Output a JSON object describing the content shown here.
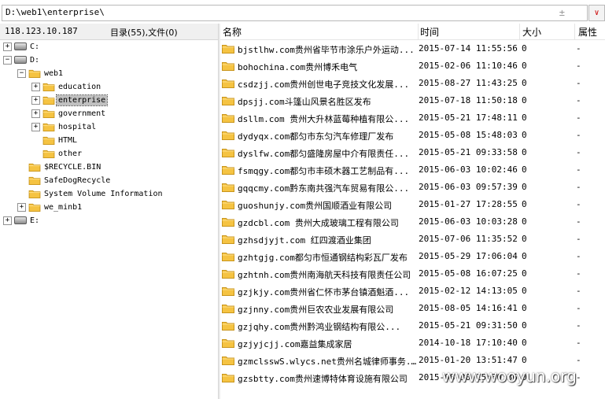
{
  "address": {
    "path": "D:\\web1\\enterprise\\",
    "icons": [
      "plus-minus-icon",
      "chevron-down-icon"
    ]
  },
  "left_header": {
    "ip": "118.123.10.187",
    "counts": "目录(55),文件(0)"
  },
  "tree": [
    {
      "label": "C:",
      "kind": "drive",
      "expander": "+"
    },
    {
      "label": "D:",
      "kind": "drive",
      "expander": "-"
    },
    {
      "label": "web1",
      "kind": "folder",
      "expander": "-"
    },
    {
      "label": "education",
      "kind": "folder",
      "expander": "+"
    },
    {
      "label": "enterprise",
      "kind": "folder",
      "expander": "+",
      "selected": true
    },
    {
      "label": "government",
      "kind": "folder",
      "expander": "+"
    },
    {
      "label": "hospital",
      "kind": "folder",
      "expander": "+"
    },
    {
      "label": "HTML",
      "kind": "folder",
      "expander": ""
    },
    {
      "label": "other",
      "kind": "folder",
      "expander": ""
    },
    {
      "label": "$RECYCLE.BIN",
      "kind": "folder",
      "expander": ""
    },
    {
      "label": "SafeDogRecycle",
      "kind": "folder",
      "expander": ""
    },
    {
      "label": "System Volume Information",
      "kind": "folder",
      "expander": ""
    },
    {
      "label": "we_minb1",
      "kind": "folder",
      "expander": "+"
    },
    {
      "label": "E:",
      "kind": "drive",
      "expander": "+"
    }
  ],
  "columns": {
    "name": "名称",
    "time": "时间",
    "size": "大小",
    "attr": "属性"
  },
  "files": [
    {
      "name": "bjstlhw.com贵州省毕节市涂乐户外运动...",
      "time": "2015-07-14 11:55:56",
      "size": "0",
      "attr": "-"
    },
    {
      "name": "bohochina.com贵州博禾电气",
      "time": "2015-02-06 11:10:46",
      "size": "0",
      "attr": "-"
    },
    {
      "name": "csdzjj.com贵州创世电子竞技文化发展...",
      "time": "2015-08-27 11:43:25",
      "size": "0",
      "attr": "-"
    },
    {
      "name": "dpsjj.com斗篷山风景名胜区发布",
      "time": "2015-07-18 11:50:18",
      "size": "0",
      "attr": "-"
    },
    {
      "name": "dsllm.com 贵州大升林蓝莓种植有限公...",
      "time": "2015-05-21 17:48:11",
      "size": "0",
      "attr": "-"
    },
    {
      "name": "dydyqx.com都匀市东匀汽车修理厂发布",
      "time": "2015-05-08 15:48:03",
      "size": "0",
      "attr": "-"
    },
    {
      "name": "dyslfw.com都匀盛隆房屋中介有限责任...",
      "time": "2015-05-21 09:33:58",
      "size": "0",
      "attr": "-"
    },
    {
      "name": "fsmqgy.com都匀市丰硕木器工艺制品有...",
      "time": "2015-06-03 10:02:46",
      "size": "0",
      "attr": "-"
    },
    {
      "name": "gqqcmy.com黔东南共强汽车贸易有限公...",
      "time": "2015-06-03 09:57:39",
      "size": "0",
      "attr": "-"
    },
    {
      "name": "guoshunjy.com贵州国顺酒业有限公司",
      "time": "2015-01-27 17:28:55",
      "size": "0",
      "attr": "-"
    },
    {
      "name": "gzdcbl.com 贵州大成玻璃工程有限公司",
      "time": "2015-06-03 10:03:28",
      "size": "0",
      "attr": "-"
    },
    {
      "name": "gzhsdjyjt.com 红四渡酒业集团",
      "time": "2015-07-06 11:35:52",
      "size": "0",
      "attr": "-"
    },
    {
      "name": "gzhtgjg.com都匀市恒通钢结构彩瓦厂发布",
      "time": "2015-05-29 17:06:04",
      "size": "0",
      "attr": "-"
    },
    {
      "name": "gzhtnh.com贵州南海航天科技有限责任公司",
      "time": "2015-05-08 16:07:25",
      "size": "0",
      "attr": "-"
    },
    {
      "name": "gzjkjy.com贵州省仁怀市茅台镇酒魁酒...",
      "time": "2015-02-12 14:13:05",
      "size": "0",
      "attr": "-"
    },
    {
      "name": "gzjnny.com贵州巨农农业发展有限公司",
      "time": "2015-08-05 14:16:41",
      "size": "0",
      "attr": "-"
    },
    {
      "name": "gzjqhy.com贵州黔鸿业钢结构有限公...",
      "time": "2015-05-21 09:31:50",
      "size": "0",
      "attr": "-"
    },
    {
      "name": "gzjyjcjj.com嘉益集成家居",
      "time": "2014-10-18 17:10:40",
      "size": "0",
      "attr": "-"
    },
    {
      "name": "gzmclsswS.wlycs.net贵州名城律师事务...",
      "time": "2015-01-20 13:51:47",
      "size": "0",
      "attr": "-"
    },
    {
      "name": "gzsbtty.com贵州速博特体育设施有限公司",
      "time": "2015-08-30 15:30:36",
      "size": "0",
      "attr": "-"
    }
  ],
  "watermark": "www.wooyun.org"
}
